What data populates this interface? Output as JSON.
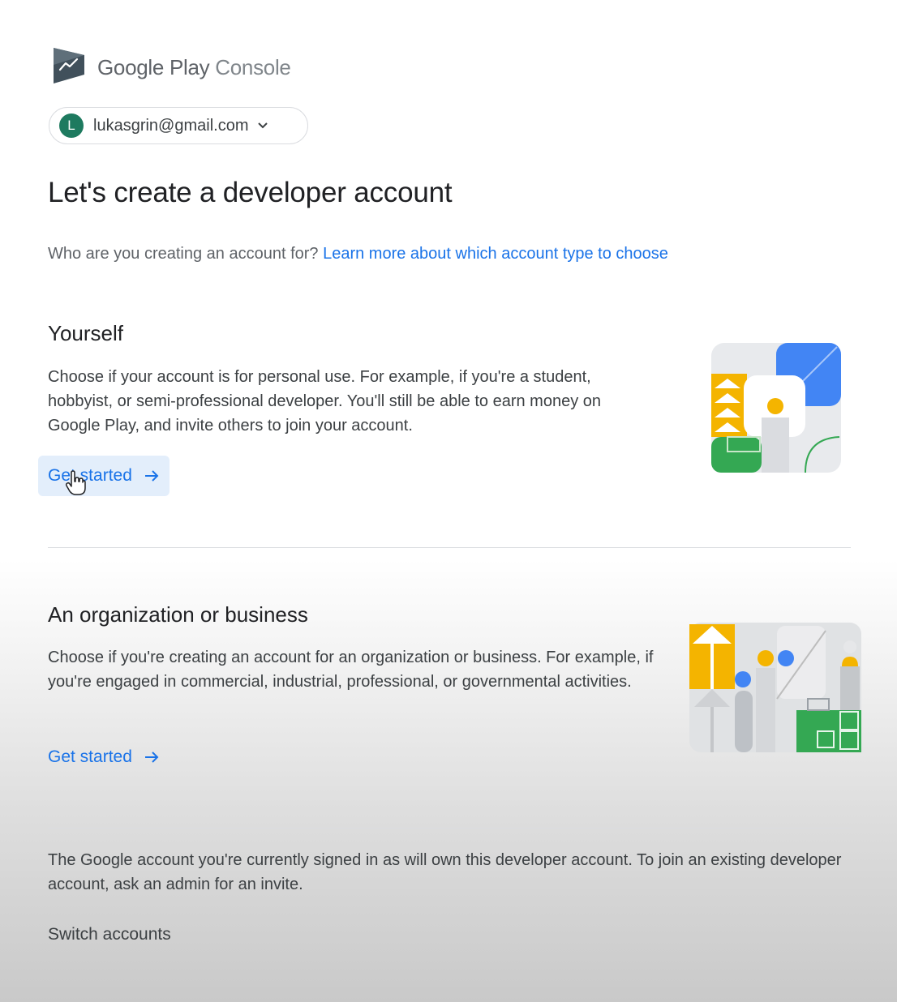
{
  "header": {
    "logo_text_google_play": "Google Play",
    "logo_text_console": "Console"
  },
  "account": {
    "avatar_letter": "L",
    "email": "lukasgrin@gmail.com",
    "avatar_color": "#1e7a5f"
  },
  "page": {
    "title": "Let's create a developer account",
    "question": "Who are you creating an account for?",
    "learn_more_link": "Learn more about which account type to choose"
  },
  "options": [
    {
      "title": "Yourself",
      "description": "Choose if your account is for personal use. For example, if you're a student, hobbyist, or semi-professional developer. You'll still be able to earn money on Google Play, and invite others to join your account.",
      "cta": "Get started"
    },
    {
      "title": "An organization or business",
      "description": "Choose if you're creating an account for an organization or business. For example, if you're engaged in commercial, industrial, professional, or governmental activities.",
      "cta": "Get started"
    }
  ],
  "footer": {
    "note": "The Google account you're currently signed in as will own this developer account. To join an existing developer account, ask an admin for an invite.",
    "switch_accounts": "Switch accounts"
  },
  "colors": {
    "accent_blue": "#1a73e8",
    "illustration_blue": "#4285f4",
    "illustration_yellow": "#f4b400",
    "illustration_green": "#34a853"
  },
  "icons": [
    "play-console-logo-icon",
    "chevron-down-icon",
    "arrow-right-icon",
    "hand-cursor-icon"
  ]
}
